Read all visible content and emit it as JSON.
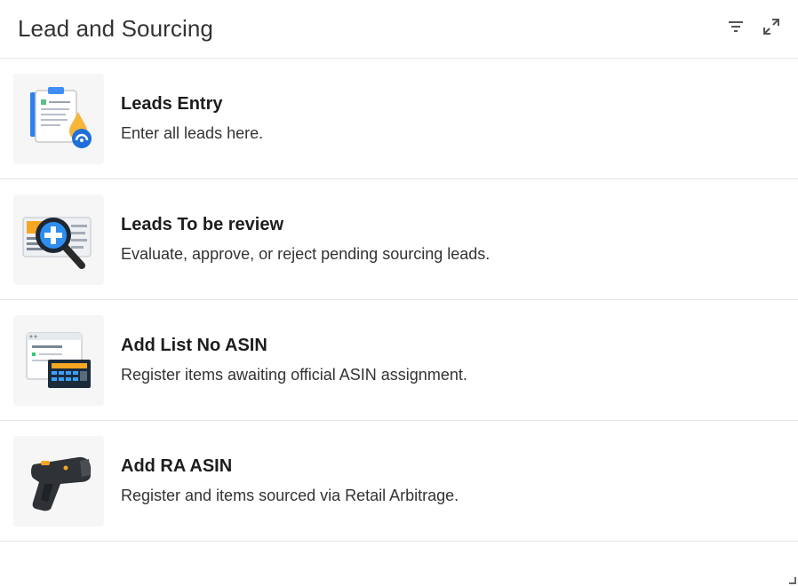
{
  "header": {
    "title": "Lead and Sourcing",
    "filter_icon": "filter-icon",
    "expand_icon": "expand-icon"
  },
  "items": [
    {
      "title": "Leads Entry",
      "description": "Enter all leads here.",
      "icon": "clipboard-icon"
    },
    {
      "title": "Leads To be review",
      "description": "Evaluate, approve, or reject pending sourcing leads.",
      "icon": "magnifier-icon"
    },
    {
      "title": "Add List No ASIN",
      "description": "Register items awaiting official ASIN assignment.",
      "icon": "dashboard-icon"
    },
    {
      "title": "Add RA ASIN",
      "description": "Register and items sourced via Retail Arbitrage.",
      "icon": "barcode-scanner-icon"
    }
  ],
  "colors": {
    "accent_blue": "#1e88e5",
    "accent_orange": "#f5a623",
    "divider": "#e3e3e3"
  }
}
